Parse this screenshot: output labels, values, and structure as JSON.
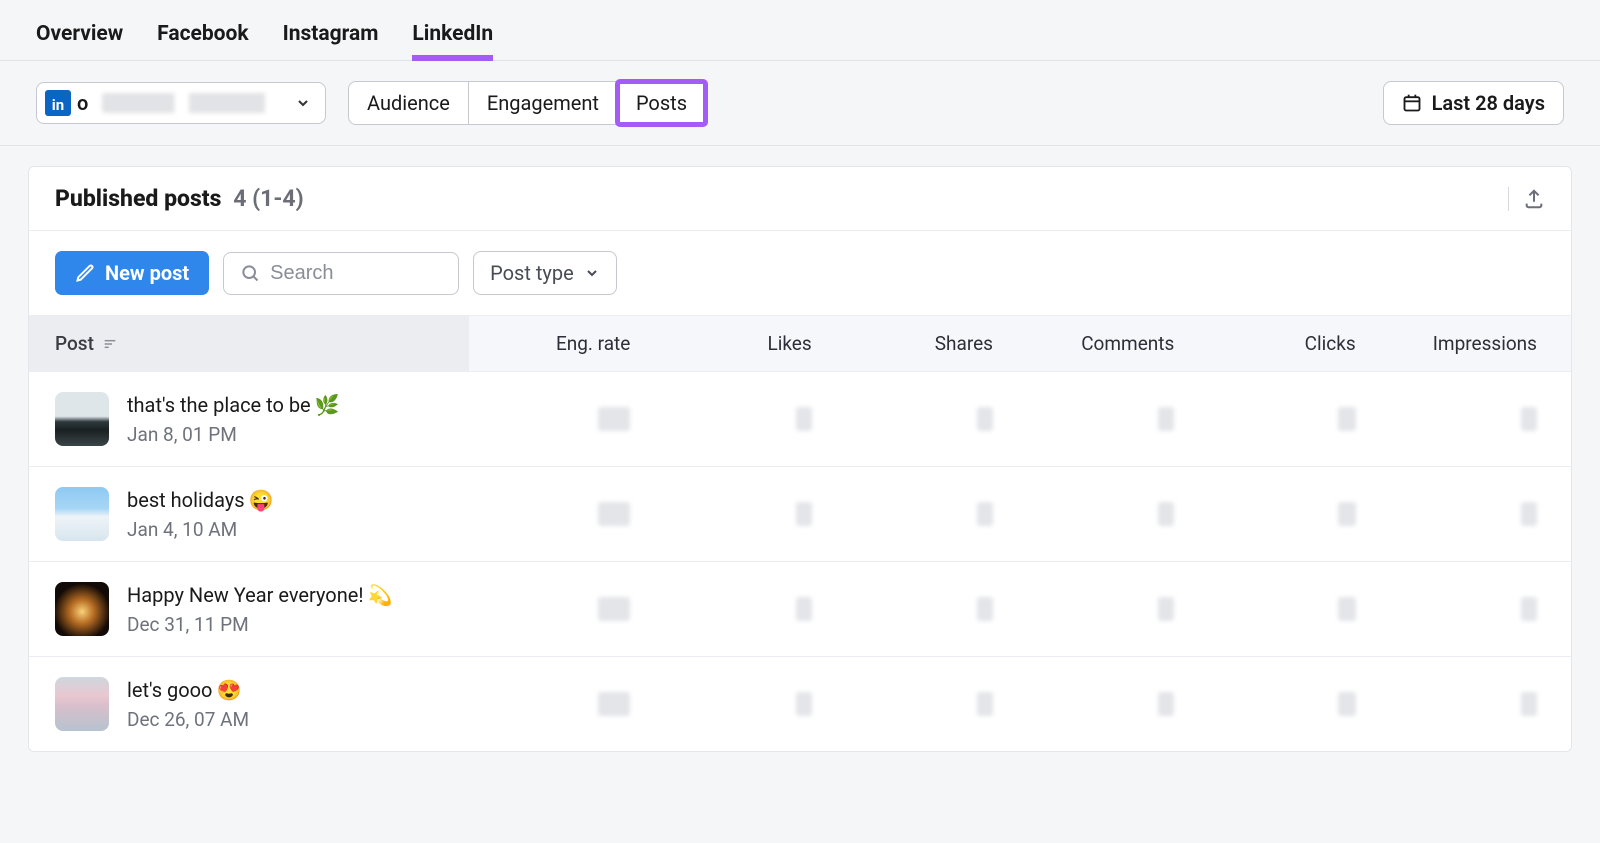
{
  "topTabs": {
    "overview": "Overview",
    "facebook": "Facebook",
    "instagram": "Instagram",
    "linkedin": "LinkedIn"
  },
  "account": {
    "prefixLetter": "o"
  },
  "segments": {
    "audience": "Audience",
    "engagement": "Engagement",
    "posts": "Posts"
  },
  "dateRange": {
    "label": "Last 28 days"
  },
  "card": {
    "title": "Published posts",
    "count": "4 (1-4)"
  },
  "toolbar": {
    "newPost": "New post",
    "searchPlaceholder": "Search",
    "postType": "Post type"
  },
  "columns": {
    "post": "Post",
    "engRate": "Eng. rate",
    "likes": "Likes",
    "shares": "Shares",
    "comments": "Comments",
    "clicks": "Clicks",
    "impressions": "Impressions"
  },
  "rows": [
    {
      "title": "that's the place to be",
      "emoji": "🌿",
      "date": "Jan 8, 01 PM"
    },
    {
      "title": "best holidays",
      "emoji": "😜",
      "date": "Jan 4, 10 AM"
    },
    {
      "title": "Happy New Year everyone!",
      "emoji": "💫",
      "date": "Dec 31, 11 PM"
    },
    {
      "title": "let's gooo",
      "emoji": "😍",
      "date": "Dec 26, 07 AM"
    }
  ]
}
